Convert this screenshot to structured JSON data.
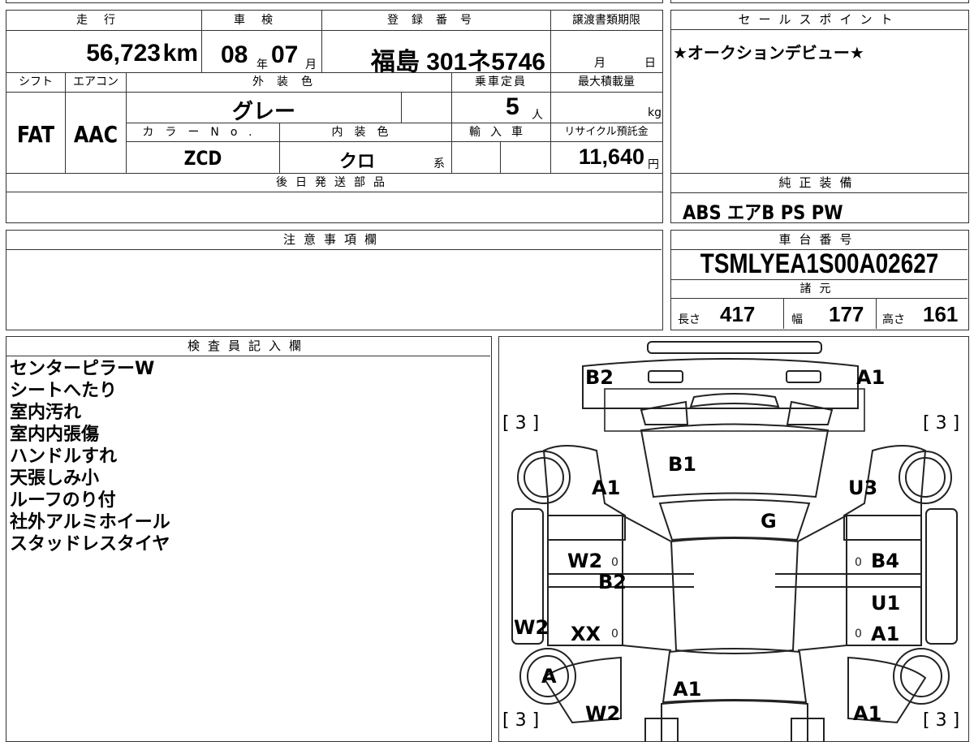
{
  "top": {
    "sou_kou_label": "走行",
    "shaken_label": "車検",
    "toroku_label": "登録番号",
    "joto_label": "譲渡書類期限",
    "mileage": "56,723",
    "mileage_unit": "km",
    "shaken_year": "08",
    "shaken_year_unit": "年",
    "shaken_month": "07",
    "shaken_month_unit": "月",
    "plate": "福島 301ネ5746",
    "joto_month_unit": "月",
    "joto_day_unit": "日",
    "shift_label": "シフト",
    "aircon_label": "エアコン",
    "exterior_label": "外装色",
    "capacity_label": "乗車定員",
    "maxload_label": "最大積載量",
    "shift": "FAT",
    "aircon": "AAC",
    "exterior": "グレー",
    "capacity": "5",
    "capacity_unit": "人",
    "maxload_unit": "kg",
    "color_no_label": "カラーNo.",
    "interior_label": "内装色",
    "import_label": "輸入車",
    "recycle_label": "リサイクル預託金",
    "color_no": "ZCD",
    "interior": "クロ",
    "interior_unit": "系",
    "recycle": "11,640",
    "recycle_unit": "円",
    "later_parts_label": "後日発送部品"
  },
  "sales": {
    "label": "セールスポイント",
    "text": "★オークションデビュー★"
  },
  "equip": {
    "label": "純正装備",
    "text": "ABS エアB PS PW"
  },
  "caution": {
    "label": "注意事項欄"
  },
  "chassis": {
    "label": "車台番号",
    "number": "TSMLYEA1S00A02627",
    "spec_label": "諸元",
    "length_label": "長さ",
    "length": "417",
    "width_label": "幅",
    "width": "177",
    "height_label": "高さ",
    "height": "161"
  },
  "inspector": {
    "label": "検査員記入欄",
    "notes": [
      "センターピラーW",
      "シートへたり",
      "室内汚れ",
      "室内内張傷",
      "ハンドルすれ",
      "天張しみ小",
      "ルーフのり付",
      "社外アルミホイール",
      "スタッドレスタイヤ"
    ]
  },
  "diagram": {
    "tl_tire": "[ 3 ]",
    "tr_tire": "[ 3 ]",
    "bl_tire": "[ 3 ]",
    "br_tire": "[ 3 ]",
    "front_left": "B2",
    "front_right": "A1",
    "hood": "B1",
    "left_fender": "A1",
    "right_fender": "U3",
    "windshield": "G",
    "left_front_door": "W2",
    "left_center": "B2",
    "right_front_door": "B4",
    "right_rear_upper": "U1",
    "left_sill": "W2",
    "left_rear_door": "XX",
    "right_rear_door": "A1",
    "left_rear_wheel": "A",
    "trunk": "A1",
    "rear_left": "W2",
    "rear_right": "A1"
  }
}
